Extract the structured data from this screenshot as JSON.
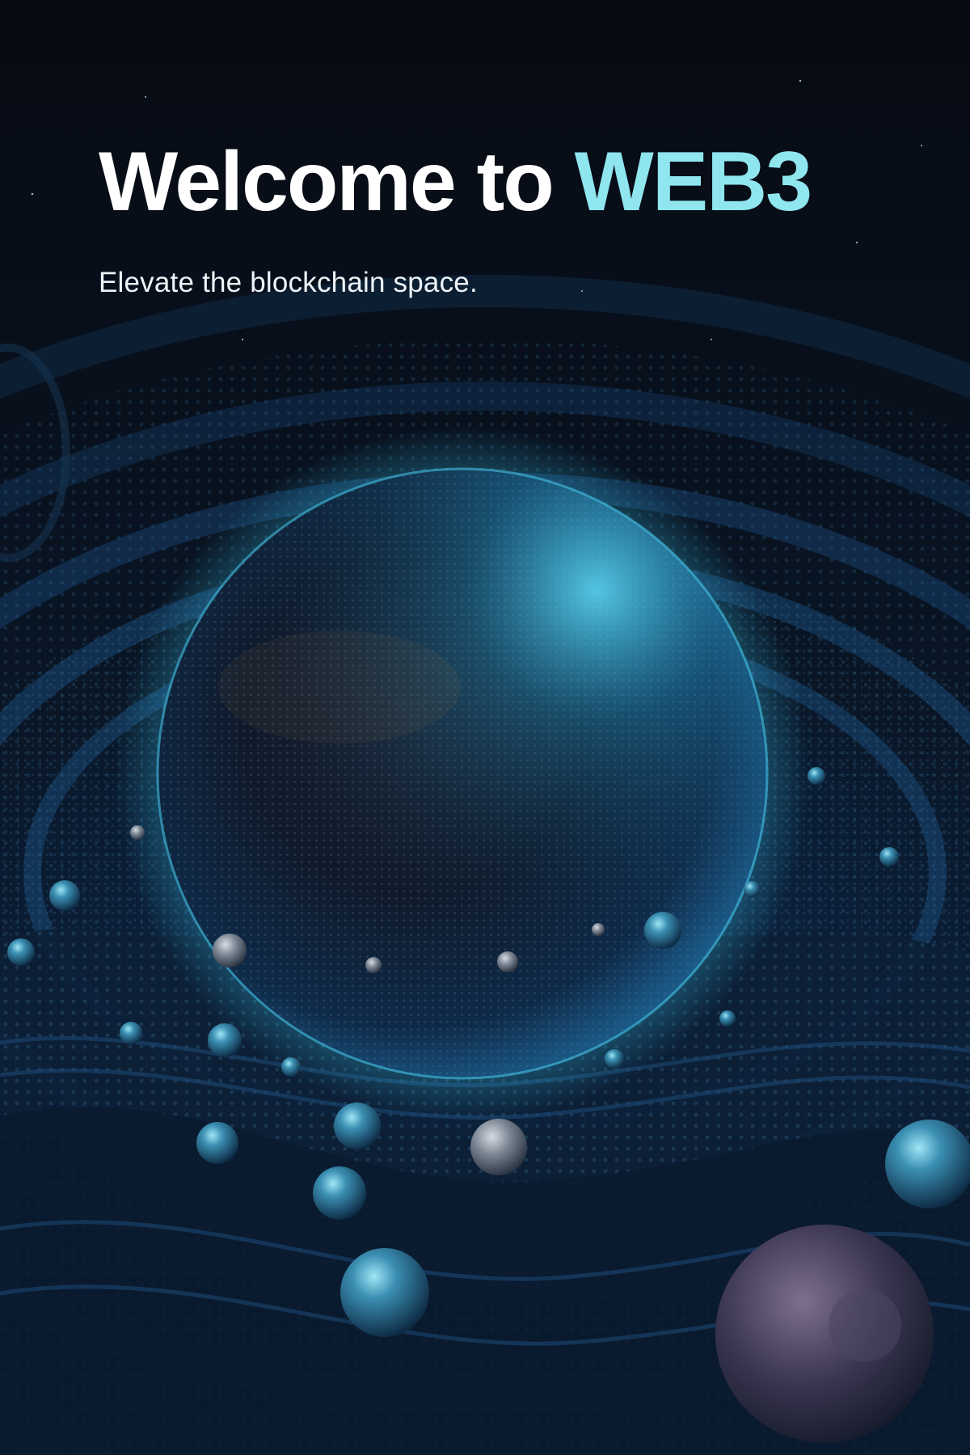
{
  "hero": {
    "title_main": "Welcome to ",
    "title_accent": "WEB3",
    "subtitle": "Elevate the blockchain space."
  },
  "colors": {
    "background": "#060b14",
    "accent": "#8fe6ef",
    "text": "#ffffff",
    "sphere_glow": "#3fd0f0"
  },
  "artwork": {
    "subject": "sphere-in-blockchain-vortex"
  }
}
